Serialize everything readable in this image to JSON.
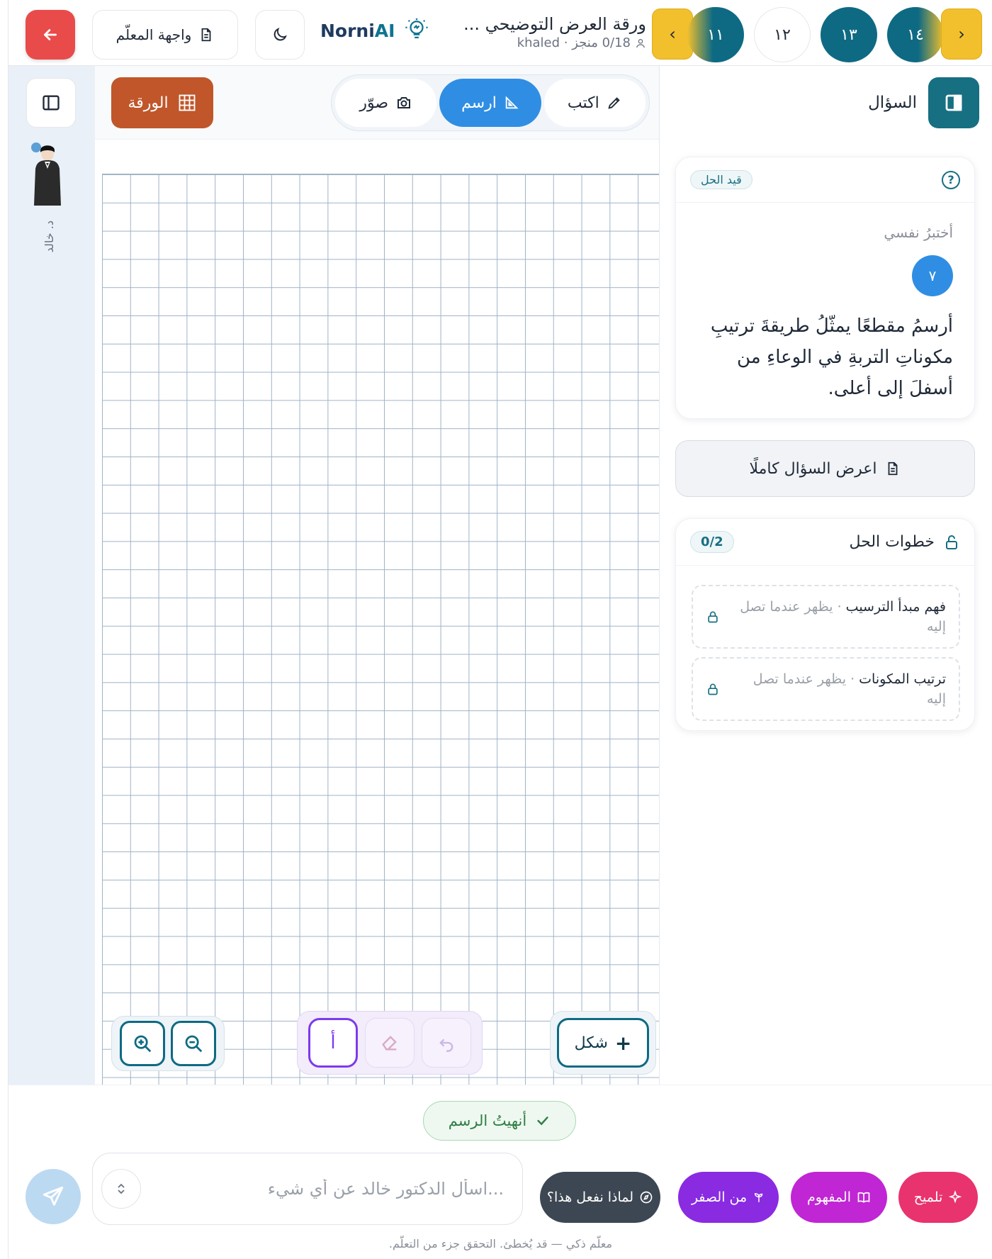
{
  "header": {
    "teacher_label": "واجهة المعلّم",
    "brand_main": "Norni",
    "brand_accent": "AI",
    "doc_title": "ورقة العرض التوضيحي ...",
    "doc_meta": "0/18 منجز · khaled",
    "pages": [
      "١١",
      "١٢",
      "١٣",
      "١٤"
    ],
    "prev_arrow": "‹",
    "next_arrow": "›"
  },
  "rail": {
    "avatar_label": "د. خالد"
  },
  "canvas": {
    "paper_label": "الورقة",
    "modes": [
      {
        "label": "اكتب",
        "icon": "pencil-icon"
      },
      {
        "label": "ارسم",
        "icon": "triangle-ruler-icon",
        "active": true
      },
      {
        "label": "صوّر",
        "icon": "camera-icon"
      }
    ],
    "text_tool": "أ",
    "shape_label": "شكل",
    "shape_plus": "+"
  },
  "panel": {
    "title": "السؤال",
    "status": "قيد الحل",
    "help": "?",
    "subtitle": "أختبرُ نفسي",
    "number": "٧",
    "question": "أرسمُ مقطعًا يمثّلُ طريقةَ ترتيبِ مكوناتِ التربةِ في الوعاءِ من أسفلَ إلى أعلى.",
    "full_question_label": "اعرض السؤال كاملًا",
    "steps_title": "خطوات الحل",
    "steps_count": "0/2",
    "steps": [
      {
        "title": "فهم مبدأ الترسيب",
        "note": "· يظهر عندما تصل إليه"
      },
      {
        "title": "ترتيب المكونات",
        "note": "· يظهر عندما تصل إليه"
      }
    ]
  },
  "bottom": {
    "done_label": "أنهيتُ الرسم",
    "chat_placeholder": "...اسأل الدكتور خالد عن أي شيء",
    "chips": {
      "why": "لماذا نفعل هذا؟",
      "scratch": "من الصفر",
      "concept": "المفهوم",
      "hint": "تلميح"
    },
    "footnote": "معلّم ذكي — قد يُخطئ. التحقق جزء من التعلّم."
  },
  "colors": {
    "back": "#e94b4b",
    "accent_teal": "#0e6a83",
    "pager_arrow": "#f2c02c",
    "draw_active": "#2f8ee3",
    "paper": "#c0562a",
    "chip_why": "#3d4753",
    "chip_scratch": "#8a2be2",
    "chip_concept": "#c026d3",
    "chip_hint": "#e8336e"
  }
}
